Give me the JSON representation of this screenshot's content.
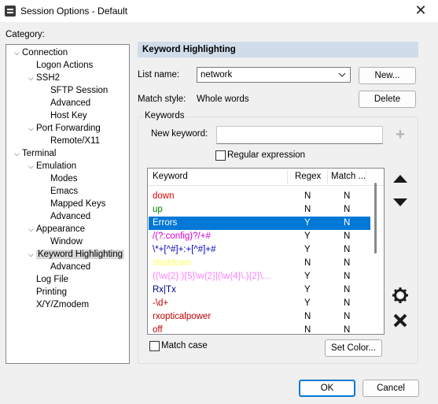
{
  "window": {
    "title": "Session Options - Default",
    "close_glyph": "✕"
  },
  "category": {
    "label": "Category:",
    "tree": [
      {
        "label": "Connection",
        "expander": "⌵"
      },
      {
        "label": "Logon Actions",
        "expander": ""
      },
      {
        "label": "SSH2",
        "expander": "⌵"
      },
      {
        "label": "SFTP Session",
        "expander": ""
      },
      {
        "label": "Advanced",
        "expander": ""
      },
      {
        "label": "Host Key",
        "expander": ""
      },
      {
        "label": "Port Forwarding",
        "expander": "⌵"
      },
      {
        "label": "Remote/X11",
        "expander": ""
      },
      {
        "label": "Terminal",
        "expander": "⌵"
      },
      {
        "label": "Emulation",
        "expander": "⌵"
      },
      {
        "label": "Modes",
        "expander": ""
      },
      {
        "label": "Emacs",
        "expander": ""
      },
      {
        "label": "Mapped Keys",
        "expander": ""
      },
      {
        "label": "Advanced",
        "expander": ""
      },
      {
        "label": "Appearance",
        "expander": "⌵"
      },
      {
        "label": "Window",
        "expander": ""
      },
      {
        "label": "Keyword Highlighting",
        "expander": "⌵",
        "selected": true
      },
      {
        "label": "Advanced",
        "expander": ""
      },
      {
        "label": "Log File",
        "expander": ""
      },
      {
        "label": "Printing",
        "expander": ""
      },
      {
        "label": "X/Y/Zmodem",
        "expander": ""
      }
    ]
  },
  "panel": {
    "header": "Keyword Highlighting",
    "list_name_label": "List name:",
    "list_name_value": "network",
    "new_button": "New...",
    "match_style_label": "Match style:",
    "match_style_value": "Whole words",
    "delete_button": "Delete",
    "keywords_group": "Keywords",
    "new_keyword_label": "New keyword:",
    "new_keyword_value": "",
    "add_glyph": "+",
    "regex_checkbox": "Regular expression",
    "columns": [
      "Keyword",
      "Regex",
      "Match ..."
    ],
    "rows": [
      {
        "keyword": "down",
        "regex": "N",
        "match": "N",
        "color": "#e00000"
      },
      {
        "keyword": "up",
        "regex": "N",
        "match": "N",
        "color": "#008000"
      },
      {
        "keyword": "Errors",
        "regex": "Y",
        "match": "N",
        "color": "#e00000",
        "selected": true
      },
      {
        "keyword": "/(?:config)?/+#",
        "regex": "Y",
        "match": "N",
        "color": "#d000d0"
      },
      {
        "keyword": "\\*+[^#]+:+[^#]+#",
        "regex": "Y",
        "match": "N",
        "color": "#0000c0"
      },
      {
        "keyword": "shutdown",
        "regex": "N",
        "match": "N",
        "color": "#ffff66"
      },
      {
        "keyword": "((\\w{2}:){5}\\w{2}|(\\w{4}\\.){2}\\...",
        "regex": "Y",
        "match": "N",
        "color": "#ff80ff"
      },
      {
        "keyword": "Rx|Tx",
        "regex": "Y",
        "match": "N",
        "color": "#000080"
      },
      {
        "keyword": "-\\d+",
        "regex": "Y",
        "match": "N",
        "color": "#c00000"
      },
      {
        "keyword": "rxopticalpower",
        "regex": "N",
        "match": "N",
        "color": "#c00000"
      },
      {
        "keyword": "off",
        "regex": "N",
        "match": "N",
        "color": "#c00000"
      }
    ],
    "match_case_checkbox": "Match case",
    "set_color_button": "Set Color..."
  },
  "footer": {
    "ok_button": "OK",
    "cancel_button": "Cancel"
  }
}
